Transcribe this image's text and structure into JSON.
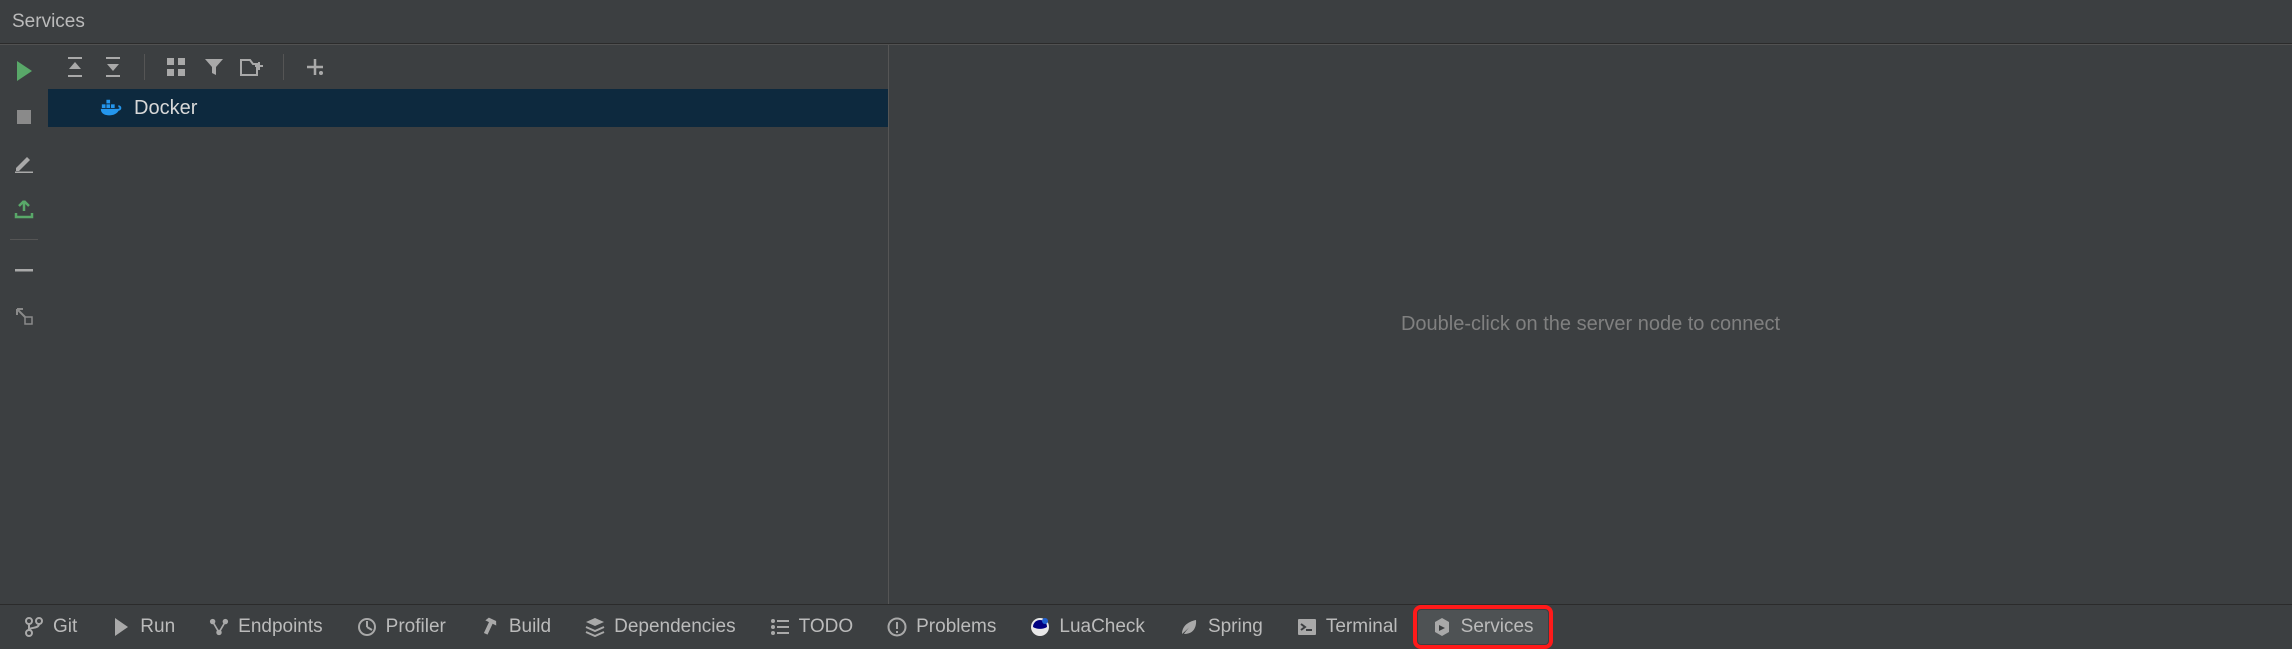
{
  "panel": {
    "title": "Services"
  },
  "tree": {
    "items": [
      {
        "label": "Docker",
        "icon": "docker-icon"
      }
    ]
  },
  "detail": {
    "hint": "Double-click on the server node to connect"
  },
  "toolwindows": [
    {
      "id": "git",
      "label": "Git",
      "icon": "branch-icon"
    },
    {
      "id": "run",
      "label": "Run",
      "icon": "play-icon"
    },
    {
      "id": "endpoints",
      "label": "Endpoints",
      "icon": "endpoints-icon"
    },
    {
      "id": "profiler",
      "label": "Profiler",
      "icon": "profiler-icon"
    },
    {
      "id": "build",
      "label": "Build",
      "icon": "hammer-icon"
    },
    {
      "id": "dependencies",
      "label": "Dependencies",
      "icon": "layers-icon"
    },
    {
      "id": "todo",
      "label": "TODO",
      "icon": "list-icon"
    },
    {
      "id": "problems",
      "label": "Problems",
      "icon": "warning-icon"
    },
    {
      "id": "luacheck",
      "label": "LuaCheck",
      "icon": "luacheck-icon"
    },
    {
      "id": "spring",
      "label": "Spring",
      "icon": "leaf-icon"
    },
    {
      "id": "terminal",
      "label": "Terminal",
      "icon": "terminal-icon"
    },
    {
      "id": "services",
      "label": "Services",
      "icon": "services-icon",
      "highlighted": true,
      "active": true
    }
  ],
  "colors": {
    "run_green": "#59a869",
    "deploy_green": "#59a869",
    "docker_blue": "#2496ed",
    "highlight_red": "#ff1a1a",
    "selection_bg": "#0d293e"
  }
}
